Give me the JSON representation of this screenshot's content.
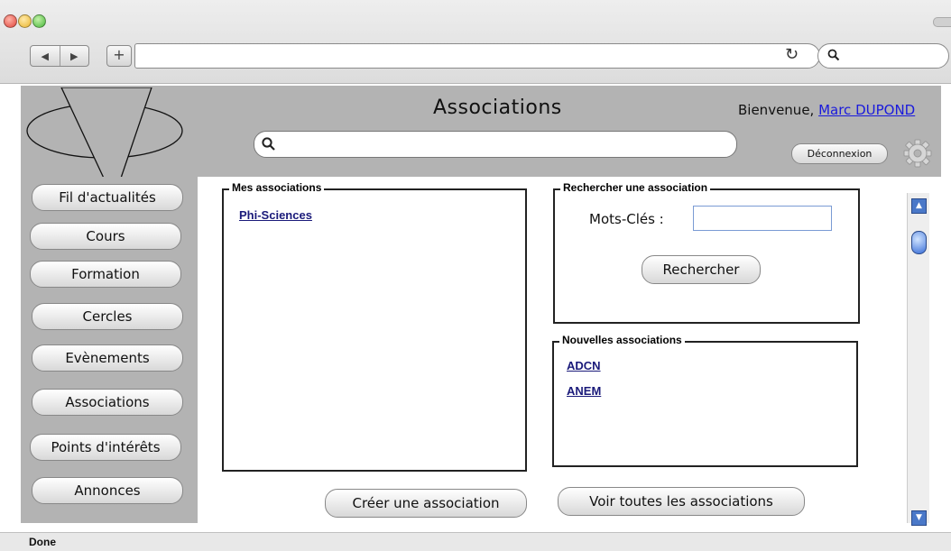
{
  "browser": {
    "back_glyph": "◀",
    "forward_glyph": "▶",
    "new_tab_glyph": "+",
    "reload_glyph": "↻",
    "url": "",
    "status": "Done"
  },
  "header": {
    "title": "Associations",
    "welcome_prefix": "Bienvenue, ",
    "user_name": "Marc DUPOND",
    "logout_label": "Déconnexion",
    "search_value": ""
  },
  "sidebar": {
    "items": [
      {
        "label": "Fil d'actualités"
      },
      {
        "label": "Cours"
      },
      {
        "label": "Formation"
      },
      {
        "label": "Cercles"
      },
      {
        "label": "Evènements"
      },
      {
        "label": "Associations"
      },
      {
        "label": "Points d'intérêts"
      },
      {
        "label": "Annonces"
      }
    ]
  },
  "my_associations": {
    "legend": "Mes associations",
    "items": [
      "Phi-Sciences"
    ]
  },
  "search_association": {
    "legend": "Rechercher une association",
    "keywords_label": "Mots-Clés :",
    "keywords_value": "",
    "search_label": "Rechercher"
  },
  "new_associations": {
    "legend": "Nouvelles associations",
    "items": [
      "ADCN",
      "ANEM"
    ]
  },
  "actions": {
    "create_label": "Créer une association",
    "view_all_label": "Voir toutes les associations"
  },
  "colors": {
    "panel_gray": "#b3b3b3",
    "link_blue": "#1a1a7a",
    "user_link": "#1a1adc"
  }
}
